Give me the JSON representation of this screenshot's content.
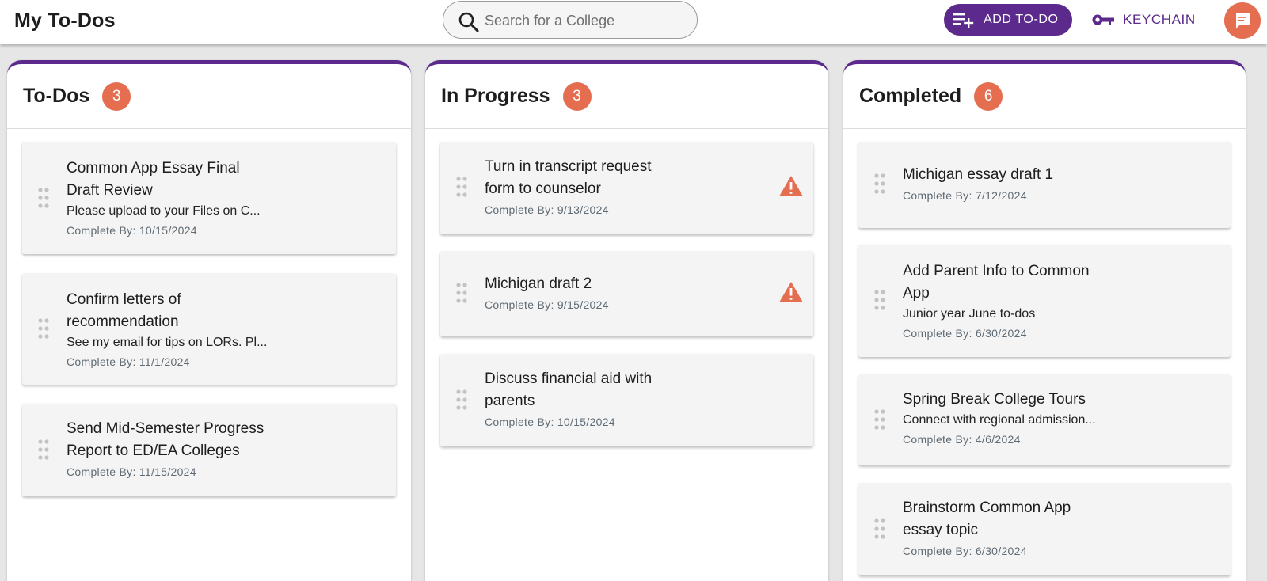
{
  "header": {
    "title": "My To-Dos",
    "search": {
      "placeholder": "Search for a College",
      "value": ""
    },
    "add_button_label": "ADD TO-DO",
    "keychain_label": "KEYCHAIN"
  },
  "colors": {
    "brand_purple": "#5b2a8c",
    "accent_orange": "#e46e4f"
  },
  "columns": [
    {
      "title": "To-Dos",
      "count": "3",
      "cards": [
        {
          "title_line1": "Common App Essay Final",
          "title_line2": "Draft Review",
          "desc": "Please upload to your Files on C...",
          "date": "Complete By: 10/15/2024"
        },
        {
          "title_line1": "Confirm letters of",
          "title_line2": "recommendation",
          "desc": "See my email for tips on LORs. Pl...",
          "date": "Complete By: 11/1/2024"
        },
        {
          "title_line1": "Send Mid-Semester Progress",
          "title_line2": "Report to ED/EA Colleges",
          "date": "Complete By: 11/15/2024"
        }
      ]
    },
    {
      "title": "In Progress",
      "count": "3",
      "cards": [
        {
          "title_line1": "Turn in transcript request",
          "title_line2": "form to counselor",
          "date": "Complete By: 9/13/2024",
          "warning_icon": "warning-triangle-icon"
        },
        {
          "title_line1": "Michigan draft 2",
          "date": "Complete By: 9/15/2024",
          "warning_icon": "warning-triangle-icon"
        },
        {
          "title_line1": "Discuss financial aid with",
          "title_line2": "parents",
          "date": "Complete By: 10/15/2024"
        }
      ]
    },
    {
      "title": "Completed",
      "count": "6",
      "cards": [
        {
          "title_line1": "Michigan essay draft 1",
          "date": "Complete By: 7/12/2024"
        },
        {
          "title_line1": "Add Parent Info to Common",
          "title_line2": "App",
          "desc": "Junior year June to-dos",
          "date": "Complete By: 6/30/2024"
        },
        {
          "title_line1": "Spring Break College Tours",
          "desc": "Connect with regional admission...",
          "date": "Complete By: 4/6/2024"
        },
        {
          "title_line1": "Brainstorm Common App",
          "title_line2": "essay topic",
          "date": "Complete By: 6/30/2024"
        }
      ]
    }
  ]
}
